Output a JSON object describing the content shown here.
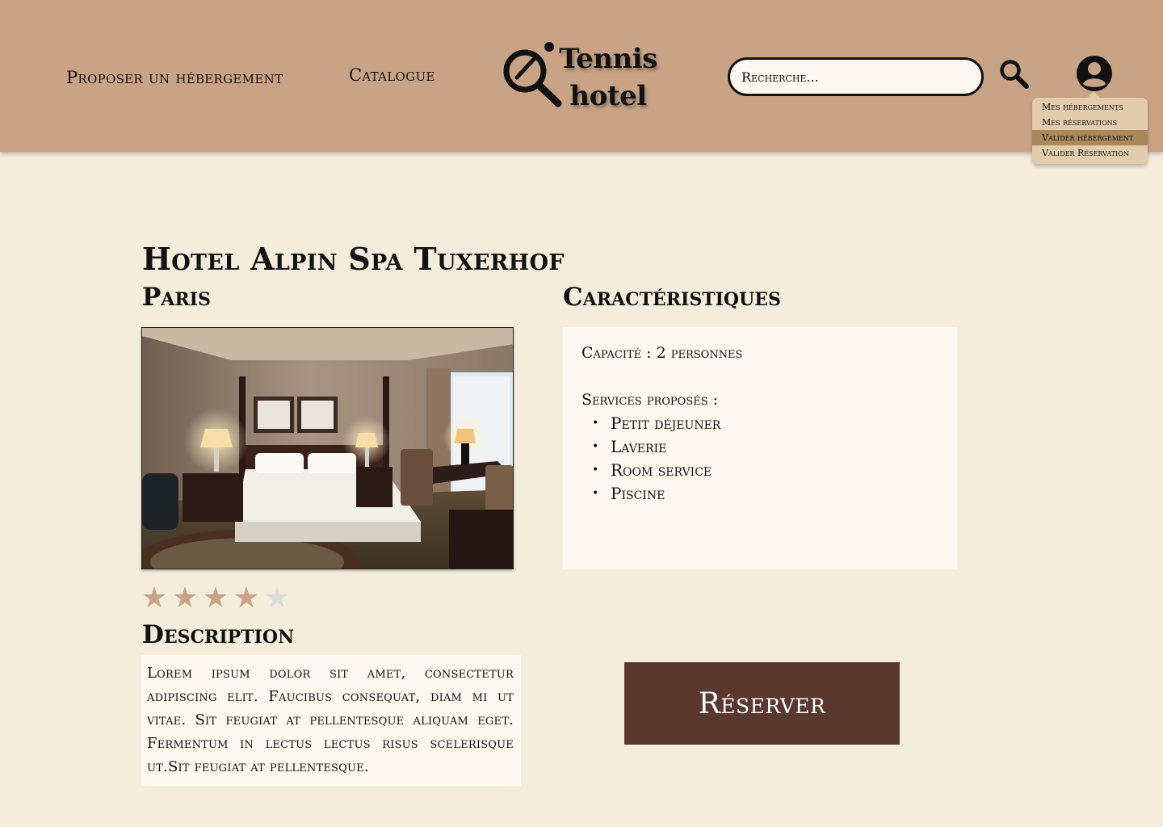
{
  "header": {
    "nav": {
      "propose_label": "Proposer un hébergement",
      "catalogue_label": "Catalogue"
    },
    "logo": {
      "line1": "Tennis",
      "line2": "hotel"
    },
    "search": {
      "placeholder": "Recherche..."
    },
    "icons": {
      "search": "search-icon",
      "user": "user-circle-icon"
    },
    "user_menu": {
      "items": [
        {
          "label": "Mes hébergements"
        },
        {
          "label": "Mes réservations"
        },
        {
          "label": "Valider hébergement",
          "active": true
        },
        {
          "label": "Valider Réservation"
        }
      ]
    }
  },
  "hotel": {
    "name": "Hotel Alpin Spa Tuxerhof",
    "city": "Paris",
    "rating": {
      "value": 4,
      "max": 5
    },
    "description_title": "Description",
    "description": "Lorem ipsum dolor sit amet, consectetur adipiscing elit. Faucibus consequat, diam mi ut vitae. Sit feugiat at pellentesque aliquam eget. Fermentum in lectus lectus risus scelerisque ut.Sit feugiat at pellentesque."
  },
  "characteristics": {
    "title": "Caractéristiques",
    "capacity": "Capacité : 2 personnes",
    "services_label": "Services proposés :",
    "services": [
      "Petit déjeuner",
      "Laverie",
      "Room service",
      "Piscine"
    ]
  },
  "actions": {
    "reserve_label": "Réserver"
  },
  "colors": {
    "header_bg": "#c8a385",
    "page_bg": "#f5eddc",
    "panel_bg": "#fdf7f1",
    "button_bg": "#5a382e",
    "dropdown_bg": "#e3ccad",
    "dropdown_active": "#a9895b",
    "star_on": "#c8a385",
    "star_off": "#dedad7"
  }
}
